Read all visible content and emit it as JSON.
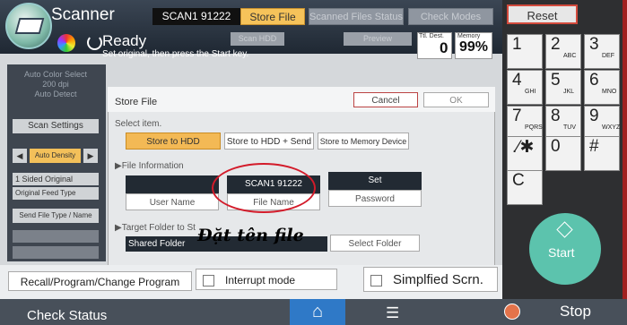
{
  "header": {
    "app_title": "Scanner",
    "document_name": "SCAN1 91222",
    "store_file_label": "Store File",
    "scanned_files_label": "Scanned Files Status",
    "check_modes_label": "Check Modes"
  },
  "status": {
    "ready": "Ready",
    "instruction": "Set original, then press the Start key.",
    "scan_hdd_label": "Scan HDD",
    "preview_label": "Preview",
    "dest_label": "Ttl. Dest.",
    "dest_value": "0",
    "memory_label": "Memory",
    "memory_value": "99%"
  },
  "left_panel": {
    "info_line1": "Auto Color Select",
    "info_line2": "200 dpi",
    "info_line3": "Auto Detect",
    "scan_settings": "Scan Settings",
    "left_arrow": "◀",
    "auto_density": "Auto Density",
    "right_arrow": "▶",
    "sided_original": "1 Sided Original",
    "feed_type": "Original Feed Type",
    "send_file_type": "Send File Type / Name"
  },
  "dialog": {
    "title": "Store File",
    "cancel": "Cancel",
    "ok": "OK",
    "select_item_label": "Select item.",
    "store_to_hdd": "Store to HDD",
    "store_to_hdd_send": "Store to HDD + Send",
    "store_to_memory": "Store to Memory Device",
    "file_info_label": "▶File Information",
    "user_name_value": "",
    "user_name": "User Name",
    "file_name_value": "SCAN1 91222",
    "file_name": "File Name",
    "set": "Set",
    "password": "Password",
    "target_folder_label": "▶Target Folder to St",
    "shared_folder": "Shared Folder",
    "select_folder": "Select Folder"
  },
  "caption": "Đặt tên file",
  "bottom": {
    "recall": "Recall/Program/Change Program",
    "interrupt": "Interrupt mode",
    "simplified": "Simplfied Scrn."
  },
  "navbar": {
    "check_status": "Check Status",
    "home": "⌂",
    "menu": "☰",
    "stop": "Stop"
  },
  "keypad": {
    "reset": "Reset",
    "keys": [
      {
        "main": "1",
        "sub": ""
      },
      {
        "main": "2",
        "sub": "ABC"
      },
      {
        "main": "3",
        "sub": "DEF"
      },
      {
        "main": "4",
        "sub": "GHI"
      },
      {
        "main": "5",
        "sub": "JKL"
      },
      {
        "main": "6",
        "sub": "MNO"
      },
      {
        "main": "7",
        "sub": "PQRS"
      },
      {
        "main": "8",
        "sub": "TUV"
      },
      {
        "main": "9",
        "sub": "WXYZ"
      },
      {
        "main": ".⁄✱",
        "sub": ""
      },
      {
        "main": "0",
        "sub": ""
      },
      {
        "main": "#",
        "sub": ""
      },
      {
        "main": "C",
        "sub": ""
      }
    ],
    "start": "Start"
  },
  "colors": {
    "accent_orange": "#f3b955",
    "start_green": "#5cc3ad",
    "annotation_red": "#d31b2a",
    "home_blue": "#2f79c7"
  }
}
